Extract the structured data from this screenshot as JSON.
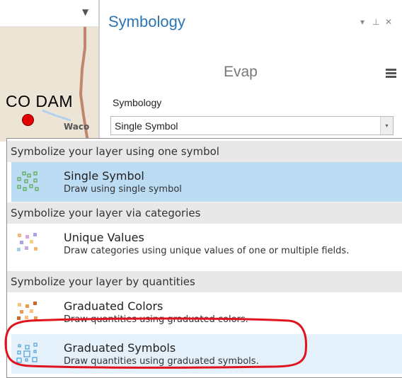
{
  "map": {
    "collapse_icon": "triangle-down",
    "dam_label": "CO DAM",
    "city_label": "Waco",
    "colors": {
      "road": "#c0876f",
      "dot": "#e30000"
    }
  },
  "pane": {
    "title": "Symbology",
    "controls": {
      "dropdown": "▾",
      "pin": "⊥",
      "close": "✕"
    },
    "layer_name": "Evap",
    "menu_icon": "hamburger-menu-icon",
    "symbology_label": "Symbology",
    "symbology_value": "Single Symbol",
    "select_arrow": "▾",
    "accent_color": "#2b75b6"
  },
  "dropdown": {
    "groups": [
      {
        "header": "Symbolize your layer using one symbol"
      },
      {
        "header": "Symbolize your layer via categories"
      },
      {
        "header": "Symbolize your layer by quantities"
      }
    ],
    "options": [
      {
        "title": "Single Symbol",
        "description": "Draw using single symbol",
        "icon": "single-symbol-icon",
        "state": "selected"
      },
      {
        "title": "Unique Values",
        "description": "Draw categories using unique values of one or multiple fields.",
        "icon": "unique-values-icon",
        "state": "normal"
      },
      {
        "title": "Graduated Colors",
        "description": "Draw quantities using graduated colors.",
        "icon": "graduated-colors-icon",
        "state": "normal"
      },
      {
        "title": "Graduated Symbols",
        "description": "Draw quantities using graduated symbols.",
        "icon": "graduated-symbols-icon",
        "state": "hover"
      }
    ],
    "selected_color": "#bcdcf4",
    "annotation_color": "#e0141e"
  }
}
